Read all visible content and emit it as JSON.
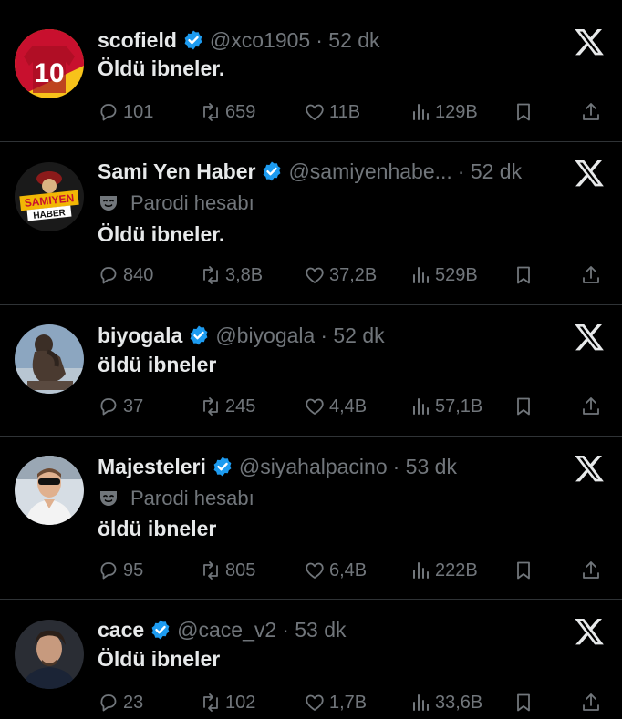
{
  "tweets": [
    {
      "name": "scofield",
      "handle": "@xco1905",
      "time": "· 52 dk",
      "parody": "",
      "text": "Öldü ibneler.",
      "replies": "101",
      "reposts": "659",
      "likes": "11B",
      "views": "129B",
      "avatar": "jersey-avatar"
    },
    {
      "name": "Sami Yen Haber",
      "handle": "@samiyenhabe...",
      "time": "· 52 dk",
      "parody": "Parodi hesabı",
      "text": "Öldü ibneler.",
      "replies": "840",
      "reposts": "3,8B",
      "likes": "37,2B",
      "views": "529B",
      "avatar": "samiyen-logo-avatar",
      "avatar_text_1": "SAMIYEN",
      "avatar_text_2": "HABER"
    },
    {
      "name": "biyogala",
      "handle": "@biyogala",
      "time": "· 52 dk",
      "parody": "",
      "text": "öldü ibneler",
      "replies": "37",
      "reposts": "245",
      "likes": "4,4B",
      "views": "57,1B",
      "avatar": "thinker-statue-avatar"
    },
    {
      "name": "Majesteleri",
      "handle": "@siyahalpacino",
      "time": "· 53 dk",
      "parody": "Parodi hesabı",
      "text": "öldü ibneler",
      "replies": "95",
      "reposts": "805",
      "likes": "6,4B",
      "views": "222B",
      "avatar": "sunglasses-man-avatar"
    },
    {
      "name": "cace",
      "handle": "@cace_v2",
      "time": "· 53 dk",
      "parody": "",
      "text": "Öldü ibneler",
      "replies": "23",
      "reposts": "102",
      "likes": "1,7B",
      "views": "33,6B",
      "avatar": "man-portrait-avatar"
    }
  ],
  "colors": {
    "background": "#000000",
    "text": "#e7e9ea",
    "muted": "#71767b",
    "verified": "#1d9bf0",
    "divider": "#2f3336"
  }
}
